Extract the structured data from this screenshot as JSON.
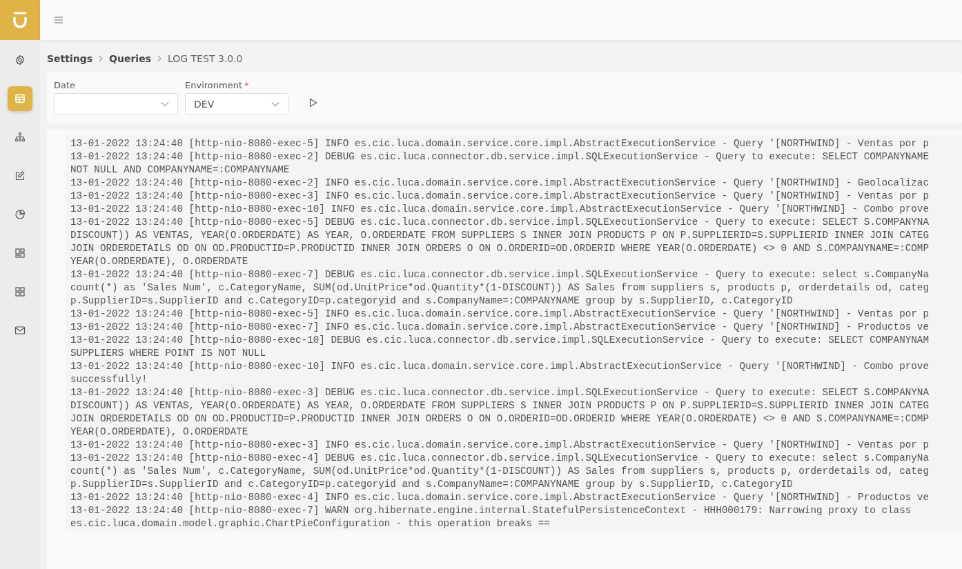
{
  "sidebar": {
    "items": [
      {
        "selected": false
      },
      {
        "selected": true
      },
      {
        "selected": false
      },
      {
        "selected": false
      },
      {
        "selected": false
      },
      {
        "selected": false
      },
      {
        "selected": false
      },
      {
        "selected": false
      }
    ]
  },
  "breadcrumb": [
    {
      "label": "Settings",
      "current": false
    },
    {
      "label": "Queries",
      "current": false
    },
    {
      "label": "LOG TEST 3.0.0",
      "current": true
    }
  ],
  "filters": [
    {
      "label": "Date"
    },
    {
      "label": "Environment",
      "required_mark": "*",
      "value": "DEV"
    }
  ],
  "log_lines": [
    "13-01-2022 13:24:40 [http-nio-8080-exec-5] INFO es.cic.luca.domain.service.core.impl.AbstractExecutionService - Query '[NORTHWIND] - Ventas por p",
    "13-01-2022 13:24:40 [http-nio-8080-exec-2] DEBUG es.cic.luca.connector.db.service.impl.SQLExecutionService - Query to execute: SELECT COMPANYNAME",
    "NOT NULL AND COMPANYNAME=:COMPANYNAME",
    "13-01-2022 13:24:40 [http-nio-8080-exec-2] INFO es.cic.luca.domain.service.core.impl.AbstractExecutionService - Query '[NORTHWIND] - Geolocalizac",
    "13-01-2022 13:24:40 [http-nio-8080-exec-3] INFO es.cic.luca.domain.service.core.impl.AbstractExecutionService - Query '[NORTHWIND] - Ventas por p",
    "13-01-2022 13:24:40 [http-nio-8080-exec-10] INFO es.cic.luca.domain.service.core.impl.AbstractExecutionService - Query '[NORTHWIND] - Combo prove",
    "13-01-2022 13:24:40 [http-nio-8080-exec-5] DEBUG es.cic.luca.connector.db.service.impl.SQLExecutionService - Query to execute: SELECT S.COMPANYNA",
    "DISCOUNT)) AS VENTAS, YEAR(O.ORDERDATE) AS YEAR, O.ORDERDATE FROM SUPPLIERS S INNER JOIN PRODUCTS P ON P.SUPPLIERID=S.SUPPLIERID INNER JOIN CATEG",
    "JOIN ORDERDETAILS OD ON OD.PRODUCTID=P.PRODUCTID INNER JOIN ORDERS O ON O.ORDERID=OD.ORDERID WHERE YEAR(O.ORDERDATE) <> 0 AND S.COMPANYNAME=:COMP",
    "YEAR(O.ORDERDATE), O.ORDERDATE",
    "13-01-2022 13:24:40 [http-nio-8080-exec-7] DEBUG es.cic.luca.connector.db.service.impl.SQLExecutionService - Query to execute: select s.CompanyNa",
    "count(*) as 'Sales Num', c.CategoryName, SUM(od.UnitPrice*od.Quantity*(1-DISCOUNT)) AS Sales from suppliers s, products p, orderdetails od, categ",
    "p.SupplierID=s.SupplierID and c.CategoryID=p.categoryid and s.CompanyName=:COMPANYNAME group by s.SupplierID, c.CategoryID",
    "13-01-2022 13:24:40 [http-nio-8080-exec-5] INFO es.cic.luca.domain.service.core.impl.AbstractExecutionService - Query '[NORTHWIND] - Ventas por p",
    "13-01-2022 13:24:40 [http-nio-8080-exec-7] INFO es.cic.luca.domain.service.core.impl.AbstractExecutionService - Query '[NORTHWIND] - Productos ve",
    "13-01-2022 13:24:40 [http-nio-8080-exec-10] DEBUG es.cic.luca.connector.db.service.impl.SQLExecutionService - Query to execute: SELECT COMPANYNAM",
    "SUPPLIERS WHERE POINT IS NOT NULL",
    "13-01-2022 13:24:40 [http-nio-8080-exec-10] INFO es.cic.luca.domain.service.core.impl.AbstractExecutionService - Query '[NORTHWIND] - Combo prove",
    "successfully!",
    "13-01-2022 13:24:40 [http-nio-8080-exec-3] DEBUG es.cic.luca.connector.db.service.impl.SQLExecutionService - Query to execute: SELECT S.COMPANYNA",
    "DISCOUNT)) AS VENTAS, YEAR(O.ORDERDATE) AS YEAR, O.ORDERDATE FROM SUPPLIERS S INNER JOIN PRODUCTS P ON P.SUPPLIERID=S.SUPPLIERID INNER JOIN CATEG",
    "JOIN ORDERDETAILS OD ON OD.PRODUCTID=P.PRODUCTID INNER JOIN ORDERS O ON O.ORDERID=OD.ORDERID WHERE YEAR(O.ORDERDATE) <> 0 AND S.COMPANYNAME=:COMP",
    "YEAR(O.ORDERDATE), O.ORDERDATE",
    "13-01-2022 13:24:40 [http-nio-8080-exec-3] INFO es.cic.luca.domain.service.core.impl.AbstractExecutionService - Query '[NORTHWIND] - Ventas por p",
    "13-01-2022 13:24:40 [http-nio-8080-exec-4] DEBUG es.cic.luca.connector.db.service.impl.SQLExecutionService - Query to execute: select s.CompanyNa",
    "count(*) as 'Sales Num', c.CategoryName, SUM(od.UnitPrice*od.Quantity*(1-DISCOUNT)) AS Sales from suppliers s, products p, orderdetails od, categ",
    "p.SupplierID=s.SupplierID and c.CategoryID=p.categoryid and s.CompanyName=:COMPANYNAME group by s.SupplierID, c.CategoryID",
    "13-01-2022 13:24:40 [http-nio-8080-exec-4] INFO es.cic.luca.domain.service.core.impl.AbstractExecutionService - Query '[NORTHWIND] - Productos ve",
    "13-01-2022 13:24:40 [http-nio-8080-exec-7] WARN org.hibernate.engine.internal.StatefulPersistenceContext - HHH000179: Narrowing proxy to class",
    "es.cic.luca.domain.model.graphic.ChartPieConfiguration - this operation breaks =="
  ]
}
